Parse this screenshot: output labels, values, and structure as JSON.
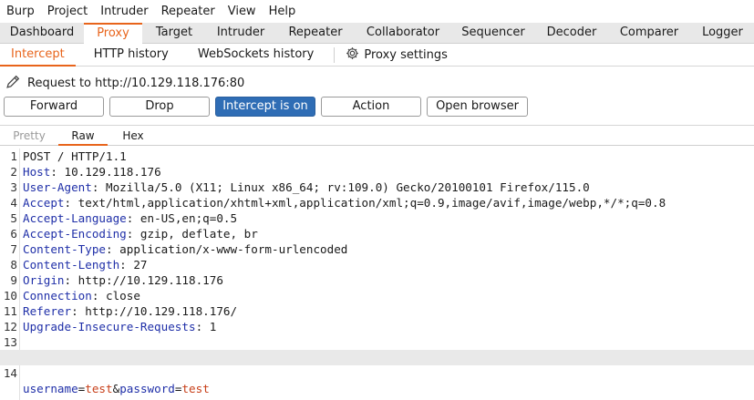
{
  "menu": [
    "Burp",
    "Project",
    "Intruder",
    "Repeater",
    "View",
    "Help"
  ],
  "main_tabs": [
    "Dashboard",
    "Proxy",
    "Target",
    "Intruder",
    "Repeater",
    "Collaborator",
    "Sequencer",
    "Decoder",
    "Comparer",
    "Logger"
  ],
  "sub_tabs": [
    "Intercept",
    "HTTP history",
    "WebSockets history"
  ],
  "proxy_settings": "Proxy settings",
  "request_label": "Request to http://10.129.118.176:80",
  "buttons": {
    "forward": "Forward",
    "drop": "Drop",
    "intercept": "Intercept is on",
    "action": "Action",
    "open_browser": "Open browser"
  },
  "view_tabs": [
    "Pretty",
    "Raw",
    "Hex"
  ],
  "request_lines": [
    {
      "n": "1",
      "text": "POST / HTTP/1.1"
    },
    {
      "n": "2",
      "name": "Host",
      "value": " 10.129.118.176"
    },
    {
      "n": "3",
      "name": "User-Agent",
      "value": " Mozilla/5.0 (X11; Linux x86_64; rv:109.0) Gecko/20100101 Firefox/115.0"
    },
    {
      "n": "4",
      "name": "Accept",
      "value": " text/html,application/xhtml+xml,application/xml;q=0.9,image/avif,image/webp,*/*;q=0.8"
    },
    {
      "n": "5",
      "name": "Accept-Language",
      "value": " en-US,en;q=0.5"
    },
    {
      "n": "6",
      "name": "Accept-Encoding",
      "value": " gzip, deflate, br"
    },
    {
      "n": "7",
      "name": "Content-Type",
      "value": " application/x-www-form-urlencoded"
    },
    {
      "n": "8",
      "name": "Content-Length",
      "value": " 27"
    },
    {
      "n": "9",
      "name": "Origin",
      "value": " http://10.129.118.176"
    },
    {
      "n": "10",
      "name": "Connection",
      "value": " close"
    },
    {
      "n": "11",
      "name": "Referer",
      "value": " http://10.129.118.176/"
    },
    {
      "n": "12",
      "name": "Upgrade-Insecure-Requests",
      "value": " 1"
    },
    {
      "n": "13",
      "text": ""
    }
  ],
  "body_line": {
    "n": "14",
    "k1": "username",
    "v1": "test",
    "k2": "password",
    "v2": "test"
  },
  "colors": {
    "accent": "#e8641b",
    "button_on": "#2f6db5",
    "header_name": "#1f2fa8",
    "param_value": "#c8401a"
  }
}
